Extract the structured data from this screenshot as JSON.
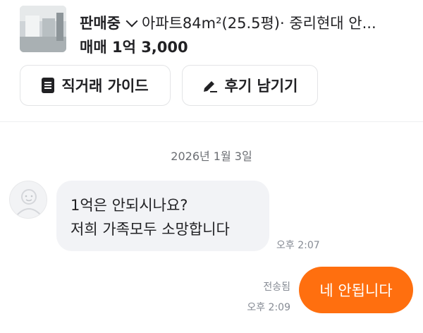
{
  "listing": {
    "status": "판매중",
    "description": "아파트84m²(25.5평)· 중리현대 안...",
    "price": "매매 1억 3,000"
  },
  "actions": {
    "guide_label": "직거래 가이드",
    "review_label": "후기 남기기"
  },
  "chat": {
    "date": "2026년 1월 3일",
    "received": {
      "line1": "1억은 안되시나요?",
      "line2": "저희 가족모두 소망합니다",
      "time": "오후 2:07"
    },
    "sent": {
      "text": "네 안됩니다",
      "status": "전송됨",
      "time": "오후 2:09"
    }
  },
  "colors": {
    "accent": "#ff6f0f",
    "bubble_in": "#f2f3f6",
    "muted_text": "#868b94"
  },
  "icons": [
    "document-icon",
    "pencil-icon",
    "chevron-down-icon",
    "default-avatar-icon"
  ]
}
